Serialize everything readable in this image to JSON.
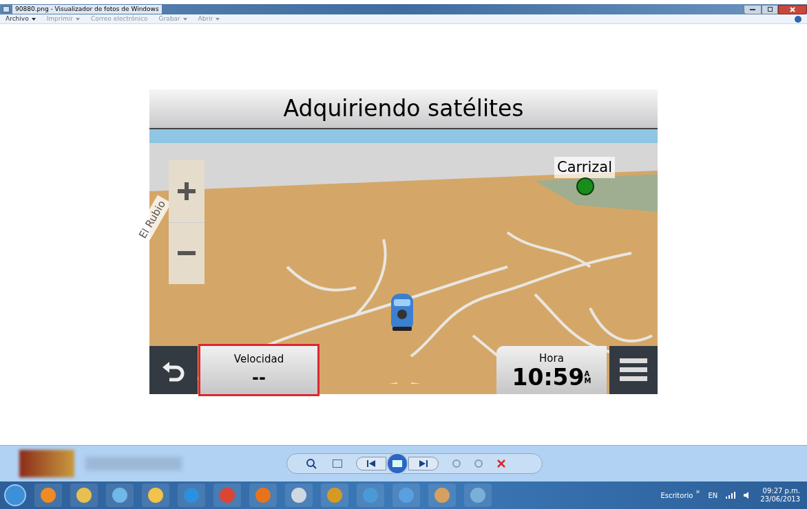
{
  "window": {
    "title": "90880.png - Visualizador de fotos de Windows"
  },
  "menu": [
    {
      "label": "Archivo",
      "disabled": false,
      "dropdown": true
    },
    {
      "label": "Imprimir",
      "disabled": true,
      "dropdown": true
    },
    {
      "label": "Correo electrónico",
      "disabled": true,
      "dropdown": false
    },
    {
      "label": "Grabar",
      "disabled": true,
      "dropdown": true
    },
    {
      "label": "Abrir",
      "disabled": true,
      "dropdown": true
    }
  ],
  "gps": {
    "title": "Adquiriendo satélites",
    "place": "Carrizal",
    "road": "El Rubio",
    "speed": {
      "label": "Velocidad",
      "value": "--"
    },
    "time": {
      "label": "Hora",
      "value": "10:59",
      "am_pm_top": "A",
      "am_pm_bottom": "M"
    }
  },
  "tray": {
    "desktop": "Escritorio",
    "more": "»",
    "language": "EN",
    "time": "09:27 p.m.",
    "date": "23/06/2013"
  }
}
